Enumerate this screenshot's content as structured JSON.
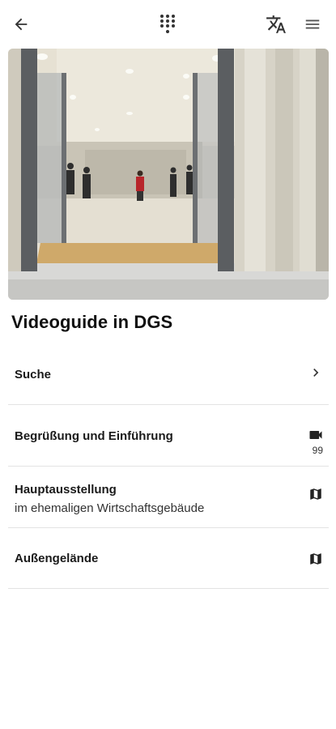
{
  "header": {
    "back_icon": "arrow-left-icon",
    "keypad_icon": "dial-pad-icon",
    "translate_icon": "translate-icon",
    "menu_icon": "hamburger-menu-icon"
  },
  "hero_image": {
    "description_icon": "museum-entrance-photo"
  },
  "page_title": "Videoguide in DGS",
  "items": [
    {
      "label": "Suche",
      "icon": "chevron-right-icon"
    },
    {
      "label": "Begrüßung und Einführung",
      "icon": "videocam-icon",
      "count": "99"
    },
    {
      "label": "Hauptausstellung",
      "subtitle": "im ehemaligen Wirtschaftsgebäude",
      "icon": "map-icon"
    },
    {
      "label": "Außengelände",
      "icon": "map-icon"
    }
  ],
  "colors": {
    "text": "#1a1a1a",
    "divider": "#e3e3e3",
    "icon": "#333333"
  }
}
